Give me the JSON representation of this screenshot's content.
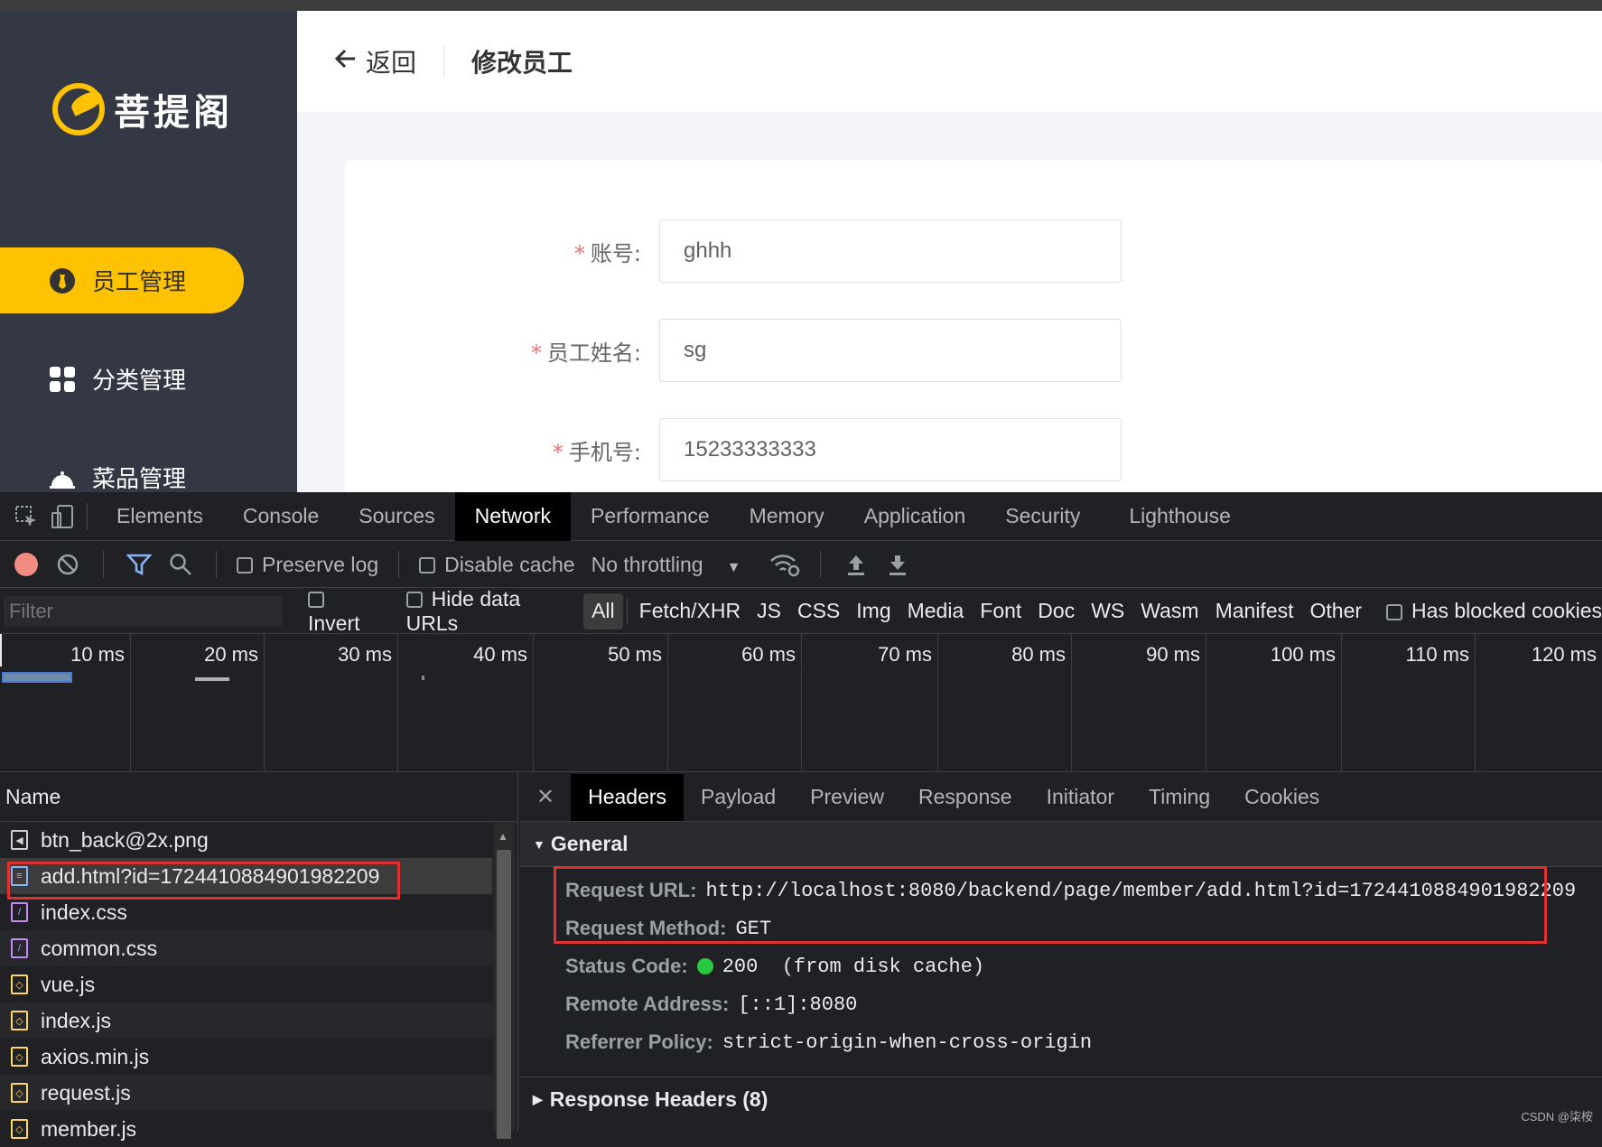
{
  "app": {
    "brand": "菩提阁",
    "nav": [
      {
        "label": "员工管理",
        "icon": "employee-icon",
        "active": true
      },
      {
        "label": "分类管理",
        "icon": "category-grid-icon",
        "active": false
      },
      {
        "label": "菜品管理",
        "icon": "dish-cloche-icon",
        "active": false
      }
    ],
    "header": {
      "back_label": "返回",
      "title": "修改员工"
    },
    "form": [
      {
        "label": "账号:",
        "value": "ghhh"
      },
      {
        "label": "员工姓名:",
        "value": "sg"
      },
      {
        "label": "手机号:",
        "value": "15233333333"
      }
    ],
    "required_mark": "*"
  },
  "devtools": {
    "tabs": [
      "Elements",
      "Console",
      "Sources",
      "Network",
      "Performance",
      "Memory",
      "Application",
      "Security",
      "Lighthouse"
    ],
    "active_tab": "Network",
    "toolbar": {
      "preserve_log": "Preserve log",
      "disable_cache": "Disable cache",
      "throttling": "No throttling"
    },
    "filter": {
      "placeholder": "Filter",
      "invert": "Invert",
      "hide_data_urls": "Hide data URLs",
      "types": [
        "All",
        "Fetch/XHR",
        "JS",
        "CSS",
        "Img",
        "Media",
        "Font",
        "Doc",
        "WS",
        "Wasm",
        "Manifest",
        "Other"
      ],
      "has_blocked": "Has blocked cookies"
    },
    "timeline_ticks": [
      "10 ms",
      "20 ms",
      "30 ms",
      "40 ms",
      "50 ms",
      "60 ms",
      "70 ms",
      "80 ms",
      "90 ms",
      "100 ms",
      "110 ms",
      "120 ms"
    ],
    "name_header": "Name",
    "requests": [
      {
        "name": "btn_back@2x.png",
        "type": "img"
      },
      {
        "name": "add.html?id=1724410884901982209",
        "type": "doc",
        "selected": true
      },
      {
        "name": "index.css",
        "type": "css"
      },
      {
        "name": "common.css",
        "type": "css"
      },
      {
        "name": "vue.js",
        "type": "js"
      },
      {
        "name": "index.js",
        "type": "js"
      },
      {
        "name": "axios.min.js",
        "type": "js"
      },
      {
        "name": "request.js",
        "type": "js"
      },
      {
        "name": "member.js",
        "type": "js"
      }
    ],
    "detail_tabs": [
      "Headers",
      "Payload",
      "Preview",
      "Response",
      "Initiator",
      "Timing",
      "Cookies"
    ],
    "general_title": "General",
    "general": {
      "request_url_key": "Request URL:",
      "request_url": "http://localhost:8080/backend/page/member/add.html?id=1724410884901982209",
      "request_method_key": "Request Method:",
      "request_method": "GET",
      "status_code_key": "Status Code:",
      "status_code": "200  (from disk cache)",
      "remote_address_key": "Remote Address:",
      "remote_address": "[::1]:8080",
      "referrer_policy_key": "Referrer Policy:",
      "referrer_policy": "strict-origin-when-cross-origin"
    },
    "response_headers_title": "Response Headers (8)"
  },
  "watermark": "CSDN @柒桉",
  "colors": {
    "accent": "#ffc200",
    "sidebar": "#343744",
    "highlight_box": "#e03030",
    "status_ok": "#28c840"
  }
}
